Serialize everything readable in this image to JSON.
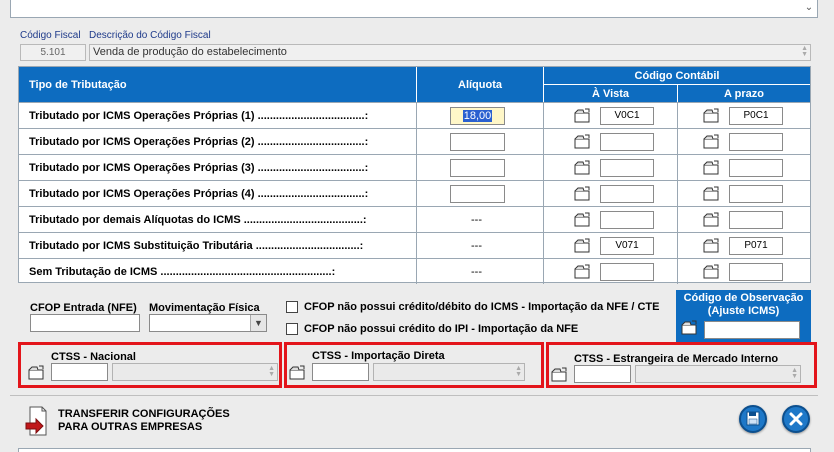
{
  "fiscal": {
    "code_label": "Código Fiscal",
    "desc_label": "Descrição do Código Fiscal",
    "code_value": "5.101",
    "desc_value": "Venda de produção do estabelecimento"
  },
  "table": {
    "col_tipo": "Tipo de Tributação",
    "col_aliquota": "Alíquota",
    "col_codigo": "Código Contábil",
    "col_avista": "À Vista",
    "col_aprazo": "A prazo",
    "rows": [
      {
        "label": "Tributado por ICMS Operações Próprias (1) ...................................:",
        "aliquota": "18,00",
        "avista": "V0C1",
        "aprazo": "P0C1"
      },
      {
        "label": "Tributado por ICMS Operações Próprias (2) ...................................:",
        "aliquota": "",
        "avista": "",
        "aprazo": ""
      },
      {
        "label": "Tributado por ICMS Operações Próprias (3) ...................................:",
        "aliquota": "",
        "avista": "",
        "aprazo": ""
      },
      {
        "label": "Tributado por ICMS Operações Próprias (4) ...................................:",
        "aliquota": "",
        "avista": "",
        "aprazo": ""
      },
      {
        "label": "Tributado por demais Alíquotas do ICMS .......................................:",
        "aliquota": "---",
        "avista": "",
        "aprazo": ""
      },
      {
        "label": "Tributado por ICMS Substituição Tributária ..................................:",
        "aliquota": "---",
        "avista": "V071",
        "aprazo": "P071"
      },
      {
        "label": "Sem Tributação de ICMS ........................................................:",
        "aliquota": "---",
        "avista": "",
        "aprazo": ""
      }
    ]
  },
  "cfop": {
    "entrada_label": "CFOP Entrada (NFE)",
    "mov_label": "Movimentação Física",
    "chk1_label": "CFOP não possui crédito/débito do ICMS -  Importação da NFE / CTE",
    "chk2_label": "CFOP não possui crédito do IPI - Importação da NFE",
    "obs_label": "Código de Observação (Ajuste ICMS)"
  },
  "ctss": {
    "nacional": "CTSS - Nacional",
    "importacao": "CTSS - Importação Direta",
    "estrangeira": "CTSS - Estrangeira de Mercado Interno"
  },
  "footer": {
    "transfer_line1": "TRANSFERIR CONFIGURAÇÕES",
    "transfer_line2": "PARA OUTRAS EMPRESAS"
  },
  "colors": {
    "header_blue": "#0d6cc0",
    "highlight_red": "#e3151b"
  }
}
